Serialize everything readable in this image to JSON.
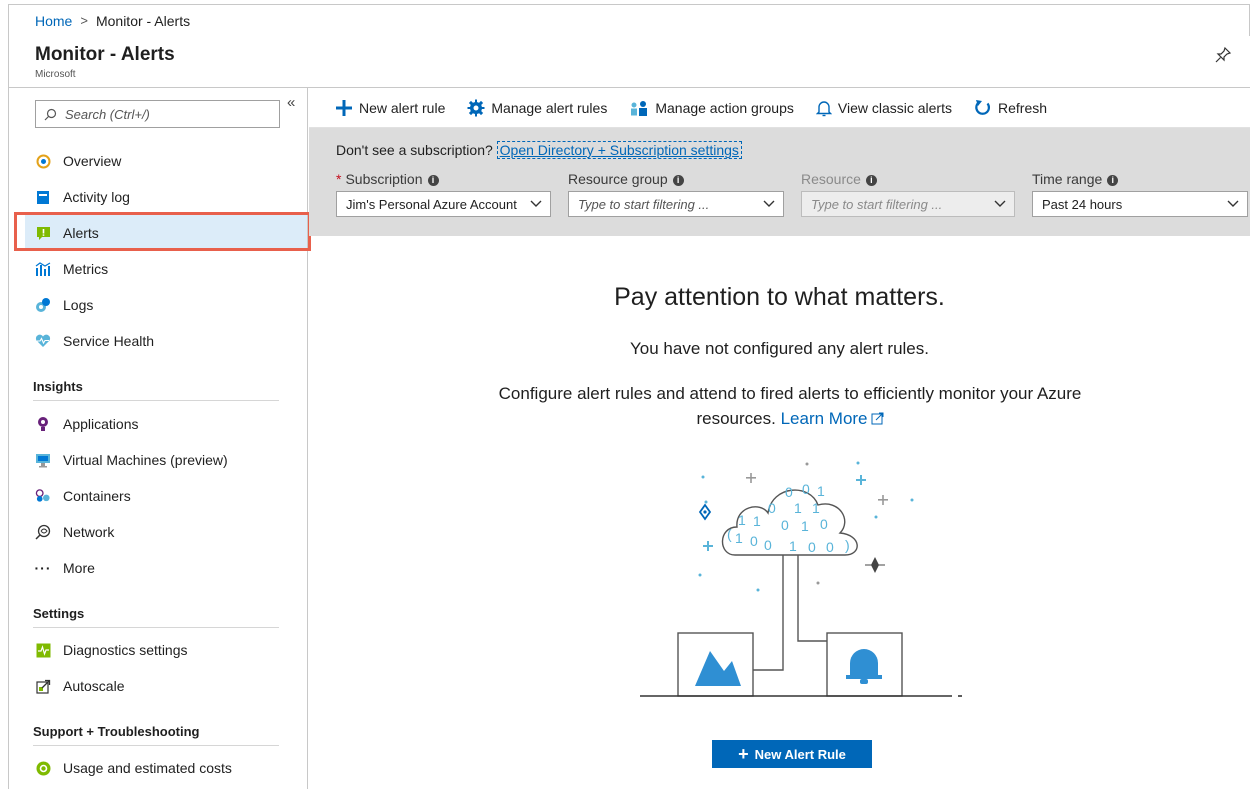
{
  "breadcrumb": {
    "home": "Home",
    "current": "Monitor - Alerts"
  },
  "header": {
    "title": "Monitor - Alerts",
    "subtitle": "Microsoft"
  },
  "sidebar": {
    "search_placeholder": "Search (Ctrl+/)",
    "collapse": "«",
    "items": [
      {
        "label": "Overview",
        "icon": "overview-icon"
      },
      {
        "label": "Activity log",
        "icon": "activity-log-icon"
      },
      {
        "label": "Alerts",
        "icon": "alerts-icon",
        "active": true
      },
      {
        "label": "Metrics",
        "icon": "metrics-icon"
      },
      {
        "label": "Logs",
        "icon": "logs-icon"
      },
      {
        "label": "Service Health",
        "icon": "service-health-icon"
      }
    ],
    "insights_heading": "Insights",
    "insights": [
      {
        "label": "Applications",
        "icon": "applications-icon"
      },
      {
        "label": "Virtual Machines (preview)",
        "icon": "virtual-machines-icon"
      },
      {
        "label": "Containers",
        "icon": "containers-icon"
      },
      {
        "label": "Network",
        "icon": "network-icon"
      },
      {
        "label": "More",
        "icon": "more-icon"
      }
    ],
    "settings_heading": "Settings",
    "settings": [
      {
        "label": "Diagnostics settings",
        "icon": "diagnostics-icon"
      },
      {
        "label": "Autoscale",
        "icon": "autoscale-icon"
      }
    ],
    "support_heading": "Support + Troubleshooting",
    "support": [
      {
        "label": "Usage and estimated costs",
        "icon": "usage-icon"
      }
    ]
  },
  "toolbar": {
    "new_alert_rule": "New alert rule",
    "manage_alert_rules": "Manage alert rules",
    "manage_action_groups": "Manage action groups",
    "view_classic_alerts": "View classic alerts",
    "refresh": "Refresh"
  },
  "filters": {
    "note": "Don't see a subscription?",
    "note_link": "Open Directory + Subscription settings",
    "subscription_label": "Subscription",
    "subscription_value": "Jim's Personal Azure Account",
    "resource_group_label": "Resource group",
    "resource_group_placeholder": "Type to start filtering ...",
    "resource_label": "Resource",
    "resource_placeholder": "Type to start filtering ...",
    "time_range_label": "Time range",
    "time_range_value": "Past 24 hours"
  },
  "main": {
    "title": "Pay attention to what matters.",
    "subtitle": "You have not configured any alert rules.",
    "description": "Configure alert rules and attend to fired alerts to efficiently monitor your Azure resources.",
    "learn_more": "Learn More",
    "button": "New Alert Rule"
  },
  "colors": {
    "accent": "#0067b8",
    "highlight": "#e8604c",
    "filter_bg": "#dcdcdc",
    "active_bg": "#dcecf9"
  }
}
